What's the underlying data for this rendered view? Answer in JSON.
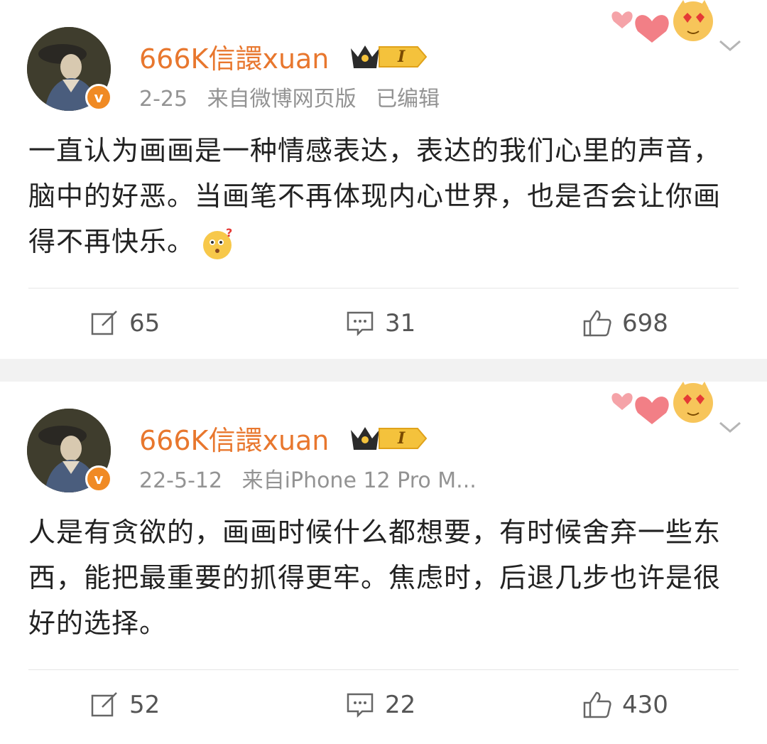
{
  "posts": [
    {
      "username": "666K信譞xuan",
      "level_badge": "I",
      "verified_mark": "v",
      "date": "2-25",
      "source": "来自微博网页版",
      "edited": "已编辑",
      "text": "一直认为画画是一种情感表达，表达的我们心里的声音，脑中的好恶。当画笔不再体现内心世界，也是否会让你画得不再快乐。",
      "emoji_icon": "wondering-face-icon",
      "reposts": "65",
      "comments": "31",
      "likes": "698"
    },
    {
      "username": "666K信譞xuan",
      "level_badge": "I",
      "verified_mark": "v",
      "date": "22-5-12",
      "source": "来自iPhone 12 Pro M...",
      "edited": "",
      "text": "人是有贪欲的，画画时候什么都想要，有时候舍弃一些东西，能把最重要的抓得更牢。焦虑时，后退几步也许是很好的选择。",
      "reposts": "52",
      "comments": "22",
      "likes": "430"
    }
  ],
  "colors": {
    "username": "#e8772e",
    "meta": "#939393",
    "verified": "#f08a24",
    "background": "#f2f2f2"
  }
}
